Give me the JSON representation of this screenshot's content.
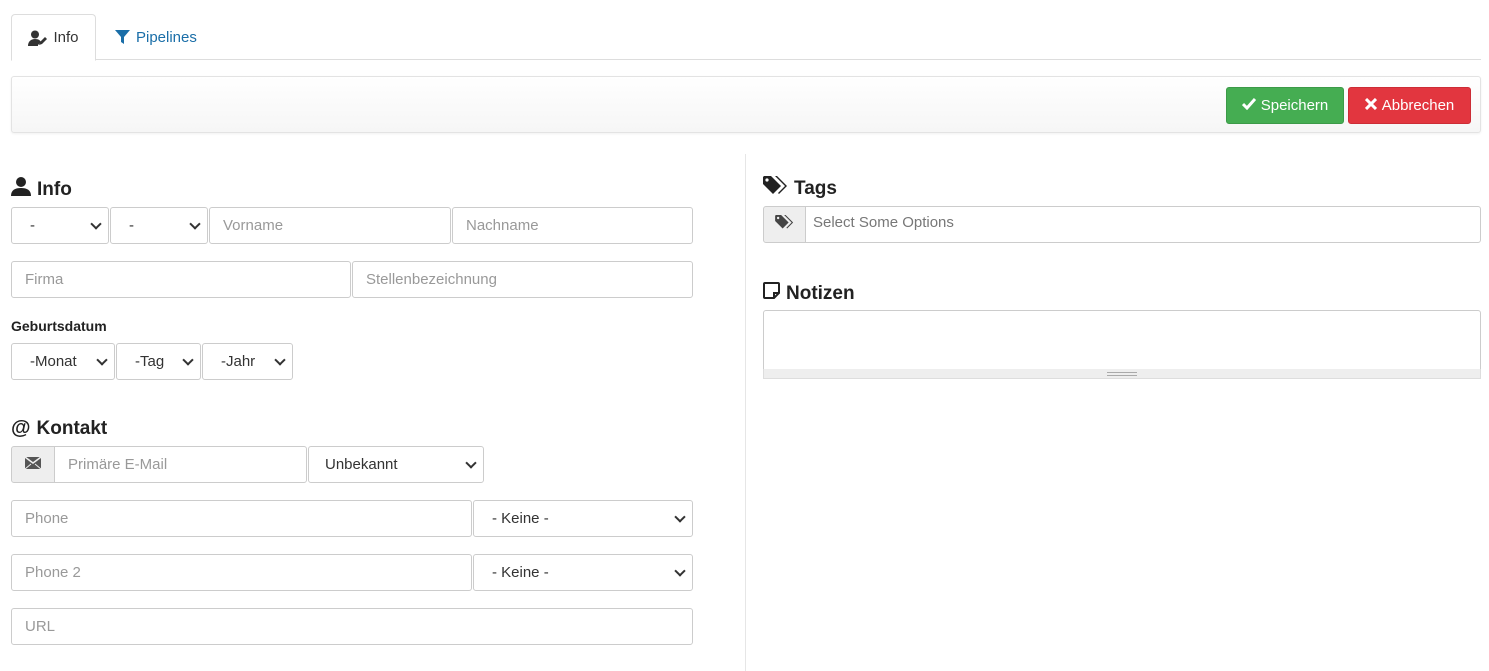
{
  "tabs": {
    "info": "Info",
    "pipelines": "Pipelines"
  },
  "toolbar": {
    "save_label": "Speichern",
    "cancel_label": "Abbrechen"
  },
  "info_section": {
    "title": "Info",
    "salutation_value": "-",
    "title_value": "-",
    "firstname_placeholder": "Vorname",
    "lastname_placeholder": "Nachname",
    "company_placeholder": "Firma",
    "jobtitle_placeholder": "Stellenbezeichnung",
    "birthday_label": "Geburtsdatum",
    "month_value": "-Monat",
    "day_value": "-Tag",
    "year_value": "-Jahr"
  },
  "contact_section": {
    "title": "Kontakt",
    "email_placeholder": "Primäre E-Mail",
    "email_status_value": "Unbekannt",
    "phone_placeholder": "Phone",
    "phone_type_value": "- Keine -",
    "phone2_placeholder": "Phone 2",
    "phone2_type_value": "- Keine -",
    "url_placeholder": "URL"
  },
  "tags_section": {
    "title": "Tags",
    "placeholder": "Select Some Options"
  },
  "notes_section": {
    "title": "Notizen"
  },
  "colors": {
    "save": "#45ad52",
    "cancel": "#e2363f",
    "link": "#1a6ea8"
  },
  "icons": {
    "info_tab": "user-edit-icon",
    "pipelines_tab": "filter-icon",
    "save": "check-icon",
    "cancel": "x-icon",
    "info_heading": "user-icon",
    "contact_heading": "at-icon",
    "email_addon": "envelope-icon",
    "tags_heading": "tags-icon",
    "tags_addon": "tags-icon",
    "notes_heading": "sticky-note-icon"
  }
}
